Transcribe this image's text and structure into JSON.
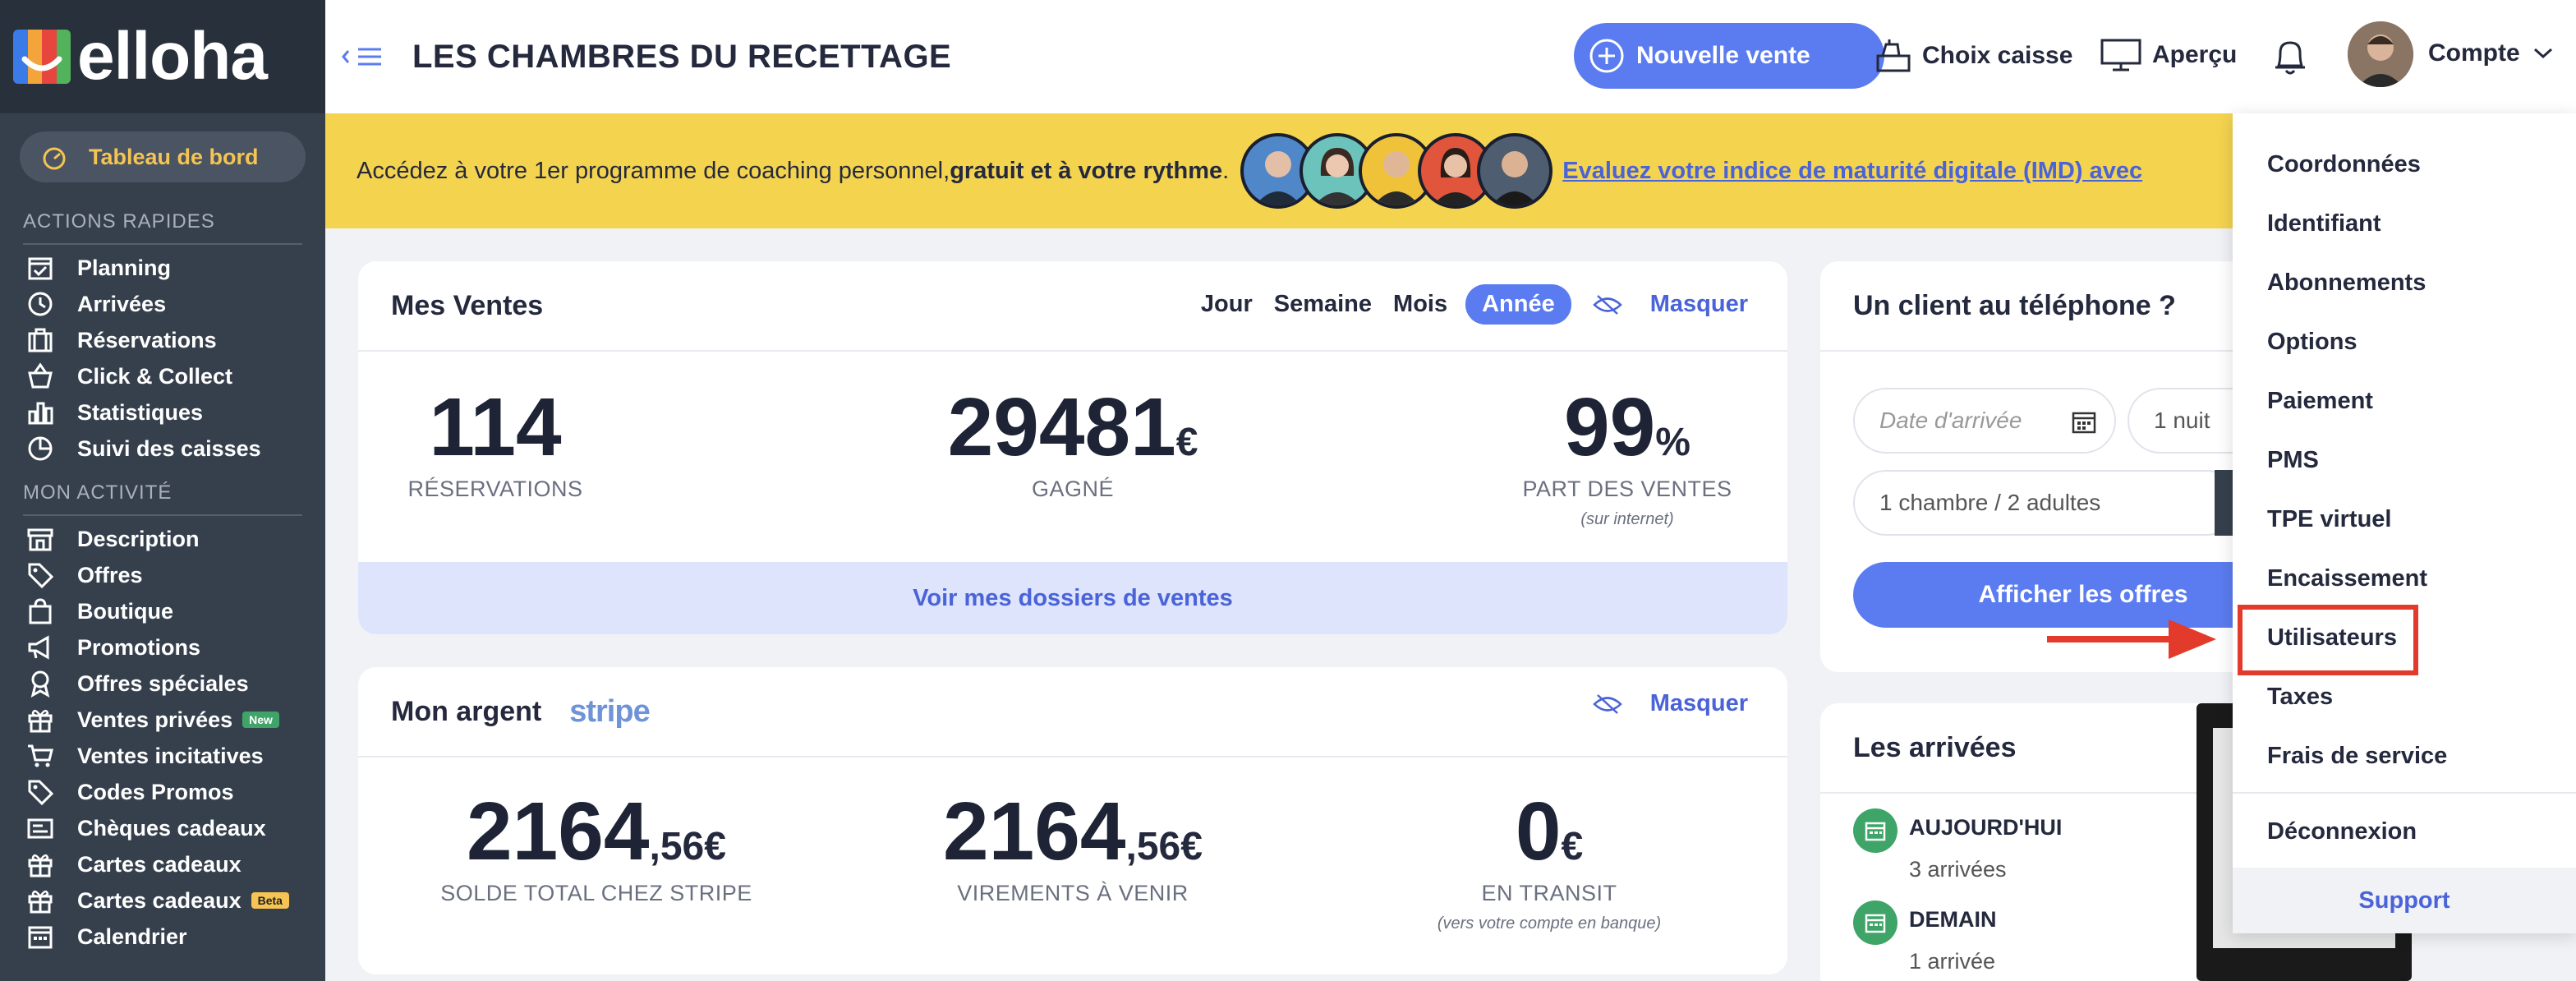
{
  "brand": {
    "name": "elloha",
    "colors": [
      "#3b7be8",
      "#f3a53c",
      "#e6463d",
      "#53b35c"
    ]
  },
  "sidebar": {
    "dashboard": "Tableau de bord",
    "section_quick": "ACTIONS RAPIDES",
    "quick_items": [
      {
        "label": "Planning",
        "icon": "calendar-check-icon"
      },
      {
        "label": "Arrivées",
        "icon": "clock-icon"
      },
      {
        "label": "Réservations",
        "icon": "suitcase-icon"
      },
      {
        "label": "Click & Collect",
        "icon": "basket-icon"
      },
      {
        "label": "Statistiques",
        "icon": "bar-chart-icon"
      },
      {
        "label": "Suivi des caisses",
        "icon": "pie-clock-icon"
      }
    ],
    "section_activity": "MON ACTIVITÉ",
    "activity_items": [
      {
        "label": "Description",
        "icon": "storefront-icon"
      },
      {
        "label": "Offres",
        "icon": "tag-icon"
      },
      {
        "label": "Boutique",
        "icon": "shopping-bag-icon"
      },
      {
        "label": "Promotions",
        "icon": "megaphone-icon"
      },
      {
        "label": "Offres spéciales",
        "icon": "award-icon"
      },
      {
        "label": "Ventes privées",
        "icon": "gift-icon",
        "badge": "New"
      },
      {
        "label": "Ventes incitatives",
        "icon": "cart-icon"
      },
      {
        "label": "Codes Promos",
        "icon": "tag-icon"
      },
      {
        "label": "Chèques cadeaux",
        "icon": "card-icon"
      },
      {
        "label": "Cartes cadeaux",
        "icon": "gift-icon"
      },
      {
        "label": "Cartes cadeaux",
        "icon": "gift-icon",
        "badge": "Beta"
      },
      {
        "label": "Calendrier",
        "icon": "calendar-icon"
      }
    ]
  },
  "header": {
    "title": "LES CHAMBRES DU RECETTAGE",
    "new_sale": "Nouvelle vente",
    "choix_caisse": "Choix caisse",
    "apercu": "Aperçu",
    "account": "Compte"
  },
  "banner": {
    "text": "Accédez à votre 1er programme de coaching personnel, ",
    "bold": "gratuit et à votre rythme",
    "dot": ".",
    "link": "Evaluez votre indice de maturité digitale (IMD) avec"
  },
  "sales": {
    "title": "Mes Ventes",
    "periods": [
      "Jour",
      "Semaine",
      "Mois"
    ],
    "active_period": "Année",
    "hide": "Masquer",
    "stats": [
      {
        "value": "114",
        "unit": "",
        "label": "RÉSERVATIONS"
      },
      {
        "value": "29481",
        "unit": "€",
        "label": "GAGNÉ"
      },
      {
        "value": "99",
        "unit": "%",
        "label": "PART DES VENTES",
        "note": "(sur internet)"
      }
    ],
    "footer": "Voir mes dossiers de ventes"
  },
  "money": {
    "title": "Mon argent",
    "provider": "stripe",
    "hide": "Masquer",
    "stats": [
      {
        "value": "2164",
        "unit": ",56€",
        "label": "SOLDE TOTAL CHEZ STRIPE"
      },
      {
        "value": "2164",
        "unit": ",56€",
        "label": "VIREMENTS À VENIR"
      },
      {
        "value": "0",
        "unit": "€",
        "label": "EN TRANSIT",
        "note": "(vers votre compte en banque)"
      }
    ]
  },
  "phone": {
    "title": "Un client au téléphone ?",
    "date_placeholder": "Date d'arrivée",
    "nights": "1 nuit",
    "rooms": "1 chambre / 2 adultes",
    "button": "Afficher les offres"
  },
  "arrivals": {
    "title": "Les arrivées",
    "rows": [
      {
        "day": "AUJOURD'HUI",
        "count": "3 arrivées"
      },
      {
        "day": "DEMAIN",
        "count": "1 arrivée"
      }
    ]
  },
  "account_menu": {
    "items": [
      "Coordonnées",
      "Identifiant",
      "Abonnements",
      "Options",
      "Paiement",
      "PMS",
      "TPE virtuel",
      "Encaissement",
      "Utilisateurs",
      "Taxes",
      "Frais de service"
    ],
    "logout": "Déconnexion",
    "support": "Support",
    "highlighted": "Utilisateurs",
    "highlight_color": "#e23b2c"
  }
}
